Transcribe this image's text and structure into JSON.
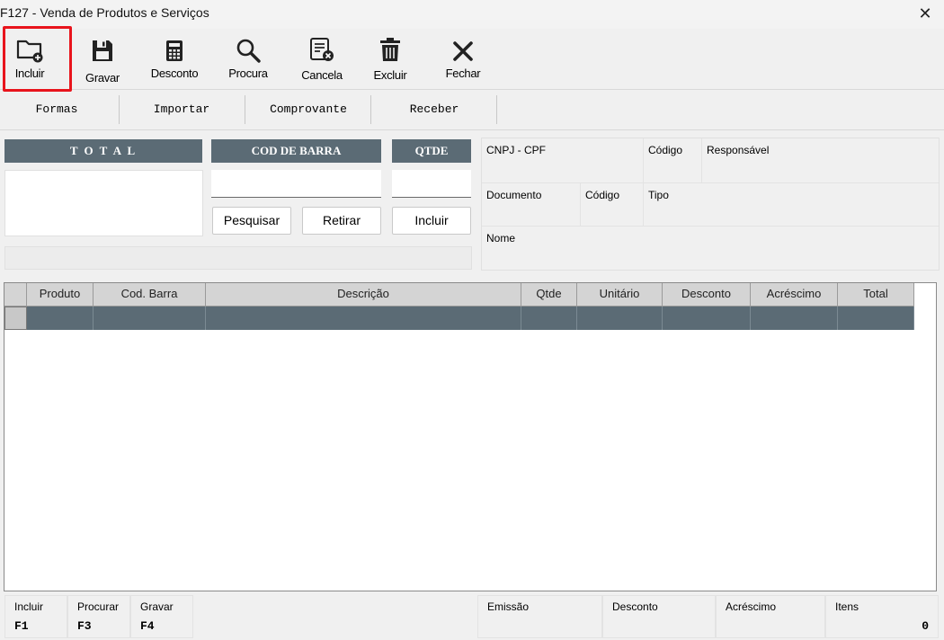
{
  "window": {
    "title": "F127 - Venda de Produtos e Serviços",
    "close_label": "✕"
  },
  "toolbar": {
    "buttons": [
      {
        "label": "Incluir",
        "icon": "folder-plus-icon",
        "highlighted": true
      },
      {
        "label": "Gravar",
        "icon": "save-icon"
      },
      {
        "label": "Desconto",
        "icon": "calculator-icon"
      },
      {
        "label": "Procura",
        "icon": "search-icon"
      },
      {
        "label": "Cancela",
        "icon": "cancel-document-icon"
      },
      {
        "label": "Excluir",
        "icon": "trash-icon"
      },
      {
        "label": "Fechar",
        "icon": "close-icon"
      }
    ],
    "highlight_color": "#e8141c"
  },
  "tabs": [
    "Formas",
    "Importar",
    "Comprovante",
    "Receber"
  ],
  "entry": {
    "total_header": "T O T A L",
    "barcode_header": "COD DE BARRA",
    "qty_header": "QTDE",
    "pesquisar_label": "Pesquisar",
    "retirar_label": "Retirar",
    "incluir_label": "Incluir"
  },
  "info": {
    "cnpj_cpf": "CNPJ - CPF",
    "codigo1": "Código",
    "responsavel": "Responsável",
    "documento": "Documento",
    "codigo2": "Código",
    "tipo": "Tipo",
    "nome": "Nome"
  },
  "grid": {
    "columns": [
      "Produto",
      "Cod. Barra",
      "Descrição",
      "Qtde",
      "Unitário",
      "Desconto",
      "Acréscimo",
      "Total"
    ],
    "header_bg": "#d4d4d4",
    "selected_row_bg": "#5b6b75"
  },
  "footer": {
    "shortcuts": [
      {
        "label": "Incluir",
        "key": "F1"
      },
      {
        "label": "Procurar",
        "key": "F3"
      },
      {
        "label": "Gravar",
        "key": "F4"
      }
    ],
    "emissao": "Emissão",
    "desconto": "Desconto",
    "acrescimo": "Acréscimo",
    "itens_label": "Itens",
    "itens_value": "0"
  }
}
